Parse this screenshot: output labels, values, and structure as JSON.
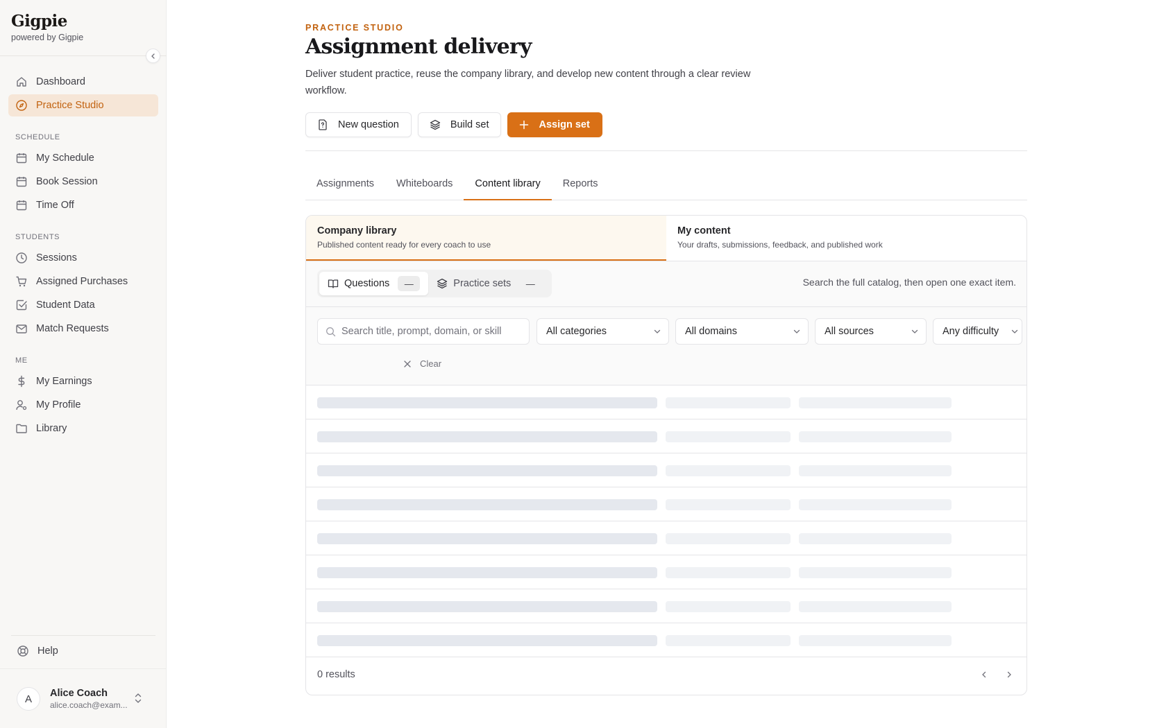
{
  "brand": {
    "name": "Gigpie",
    "sub": "powered by Gigpie"
  },
  "sidebar": {
    "top": [
      {
        "label": "Dashboard",
        "icon": "home-icon"
      },
      {
        "label": "Practice Studio",
        "icon": "compass-icon",
        "active": true
      }
    ],
    "sections": [
      {
        "title": "SCHEDULE",
        "items": [
          {
            "label": "My Schedule",
            "icon": "calendar-icon"
          },
          {
            "label": "Book Session",
            "icon": "calendar-icon"
          },
          {
            "label": "Time Off",
            "icon": "calendar-icon"
          }
        ]
      },
      {
        "title": "STUDENTS",
        "items": [
          {
            "label": "Sessions",
            "icon": "clock-icon"
          },
          {
            "label": "Assigned Purchases",
            "icon": "cart-icon"
          },
          {
            "label": "Student Data",
            "icon": "checkbox-icon"
          },
          {
            "label": "Match Requests",
            "icon": "mail-icon"
          }
        ]
      },
      {
        "title": "ME",
        "items": [
          {
            "label": "My Earnings",
            "icon": "dollar-icon"
          },
          {
            "label": "My Profile",
            "icon": "user-icon"
          },
          {
            "label": "Library",
            "icon": "folder-icon"
          }
        ]
      }
    ],
    "help": "Help",
    "user": {
      "initial": "A",
      "name": "Alice Coach",
      "email": "alice.coach@exam..."
    }
  },
  "header": {
    "eyebrow": "PRACTICE STUDIO",
    "title": "Assignment delivery",
    "description": "Deliver student practice, reuse the company library, and develop new content through a clear review workflow."
  },
  "actions": {
    "new_question": "New question",
    "build_set": "Build set",
    "assign_set": "Assign set"
  },
  "tabs": [
    "Assignments",
    "Whiteboards",
    "Content library",
    "Reports"
  ],
  "library": {
    "company": {
      "title": "Company library",
      "sub": "Published content ready for every coach to use"
    },
    "mine": {
      "title": "My content",
      "sub": "Your drafts, submissions, feedback, and published work"
    }
  },
  "types": {
    "questions": {
      "label": "Questions",
      "count": "—"
    },
    "sets": {
      "label": "Practice sets",
      "count": "—"
    },
    "hint": "Search the full catalog, then open one exact item."
  },
  "filters": {
    "search_placeholder": "Search title, prompt, domain, or skill",
    "category": "All categories",
    "domain": "All domains",
    "source": "All sources",
    "difficulty": "Any difficulty",
    "clear": "Clear"
  },
  "footer": {
    "results": "0 results"
  },
  "colors": {
    "accent": "#d97016",
    "accent_text": "#c2620f",
    "active_bg": "#f6e6d7"
  }
}
